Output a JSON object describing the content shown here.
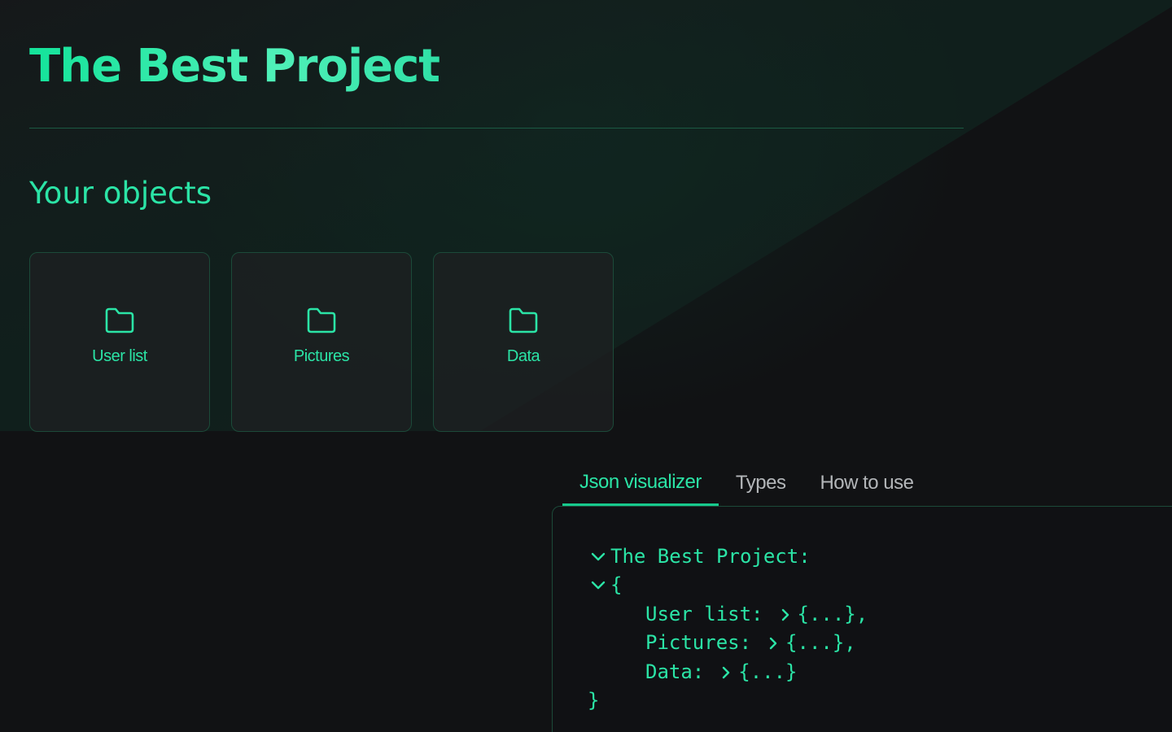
{
  "header": {
    "title": "The Best Project"
  },
  "objects": {
    "title": "Your objects",
    "items": [
      {
        "label": "User list",
        "icon": "folder-icon"
      },
      {
        "label": "Pictures",
        "icon": "folder-icon"
      },
      {
        "label": "Data",
        "icon": "folder-icon"
      }
    ]
  },
  "tabs": [
    {
      "label": "Json visualizer",
      "active": true
    },
    {
      "label": "Types",
      "active": false
    },
    {
      "label": "How to use",
      "active": false
    }
  ],
  "json_view": {
    "root_label": "The Best Project:",
    "open_brace": "{",
    "close_brace": "}",
    "entries": [
      {
        "key": "User list:",
        "value": "{...},",
        "expand_icon": "chevron-right-icon"
      },
      {
        "key": "Pictures:",
        "value": "{...},",
        "expand_icon": "chevron-right-icon"
      },
      {
        "key": "Data:",
        "value": "{...}",
        "expand_icon": "chevron-right-icon"
      }
    ]
  },
  "colors": {
    "accent": "#2be4a6",
    "background": "#111214",
    "border": "#1c4a39",
    "inactive_tab": "#b3b6b9"
  }
}
